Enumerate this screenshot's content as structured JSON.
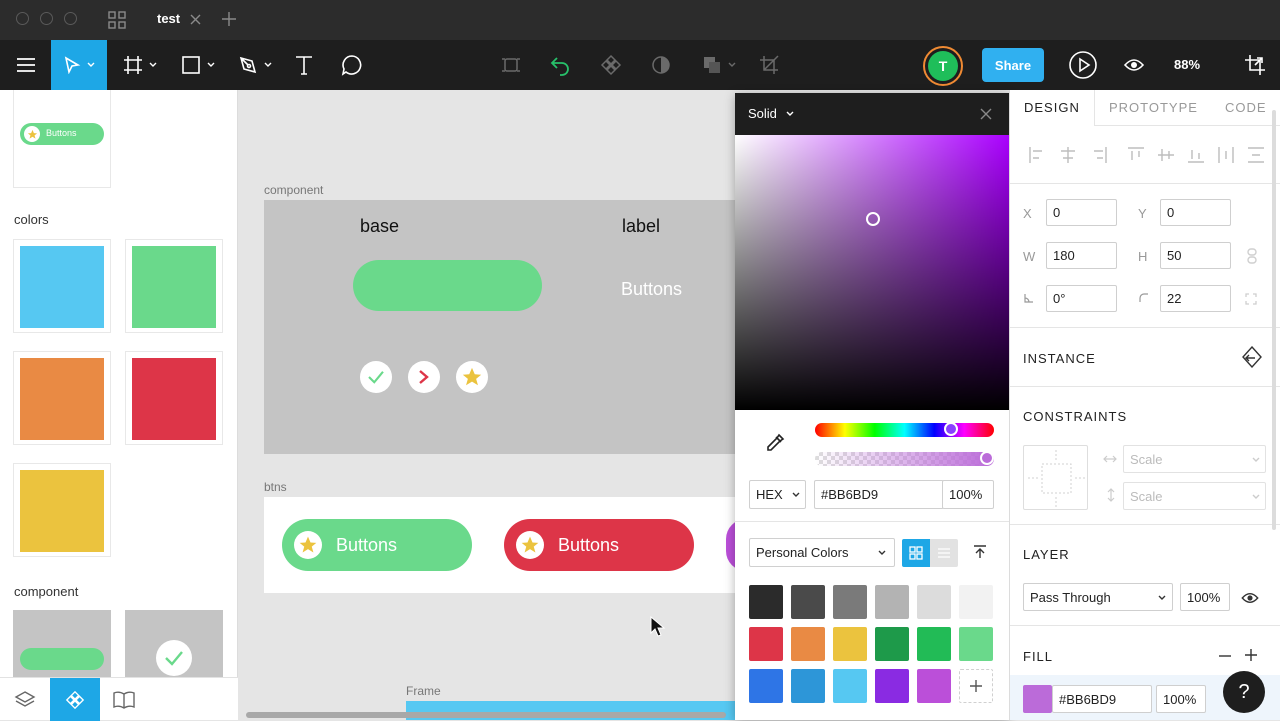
{
  "titlebar": {
    "tab_name": "test"
  },
  "toolbar": {
    "share_label": "Share",
    "avatar_initial": "T",
    "zoom_level": "88%"
  },
  "left_panel": {
    "colors_heading": "colors",
    "component_heading": "component",
    "thumb_button_label": "Buttons",
    "color_swatches": [
      "#56c8f2",
      "#6ad98b",
      "#e98a44",
      "#dd3548",
      "#ebc33e"
    ]
  },
  "canvas": {
    "component_frame_label": "component",
    "base_label": "base",
    "label_label": "label",
    "label_text": "Buttons",
    "btns_frame_label": "btns",
    "button1_label": "Buttons",
    "button2_label": "Buttons",
    "frame_label": "Frame"
  },
  "color_picker": {
    "mode": "Solid",
    "color_format": "HEX",
    "hex_value": "#BB6BD9",
    "opacity": "100%",
    "library": "Personal Colors",
    "palette": [
      "#2b2b2b",
      "#4a4a4a",
      "#7a7a7a",
      "#b3b3b3",
      "#dcdcdc",
      "#f2f2f2",
      "#dd3548",
      "#e98a44",
      "#ebc33e",
      "#1e9a4a",
      "#22bb56",
      "#6ad98b",
      "#2e75e6",
      "#2d96d8",
      "#56c8f2",
      "#8a2be2",
      "#bb4fd9"
    ]
  },
  "right_panel": {
    "tabs": [
      "DESIGN",
      "PROTOTYPE",
      "CODE"
    ],
    "x_label": "X",
    "x_value": "0",
    "y_label": "Y",
    "y_value": "0",
    "w_label": "W",
    "w_value": "180",
    "h_label": "H",
    "h_value": "50",
    "rotation_value": "0°",
    "radius_value": "22",
    "instance_heading": "INSTANCE",
    "constraints_heading": "CONSTRAINTS",
    "constraint_h": "Scale",
    "constraint_v": "Scale",
    "layer_heading": "LAYER",
    "blend_mode": "Pass Through",
    "layer_opacity": "100%",
    "fill_heading": "FILL",
    "fill_hex": "#BB6BD9",
    "fill_opacity": "100%",
    "fill_color": "#BB6BD9"
  },
  "colors": {
    "accent": "#30b0f0",
    "toolbar_bg": "#1e1e1e",
    "active_tool": "#1ea7e6"
  }
}
